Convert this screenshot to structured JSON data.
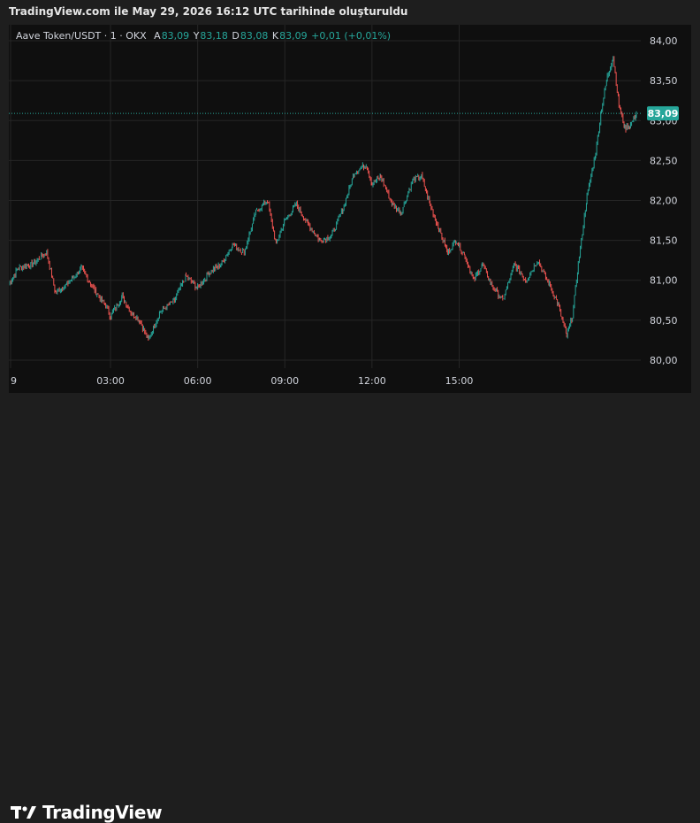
{
  "snapshot_title": "TradingView.com ile May 29, 2026 16:12 UTC tarihinde oluşturuldu",
  "legend": {
    "symbol": "Aave Token/USDT · 1 · OKX",
    "open_label": "A",
    "open": "83,09",
    "high_label": "Y",
    "high": "83,18",
    "low_label": "D",
    "low": "83,08",
    "close_label": "K",
    "close": "83,09",
    "change": "+0,01 (+0,01%)"
  },
  "price_tag": "83,09",
  "brand_name": "TradingView",
  "colors": {
    "up": "#26a69a",
    "down": "#ef5350",
    "panel_bg": "#0f0f0f",
    "page_bg": "#1e1e1e",
    "grid": "#262626"
  },
  "chart_data": {
    "type": "line",
    "title": "Aave Token/USDT · 1 · OKX",
    "xlabel": "",
    "ylabel": "",
    "x_ticks": [
      {
        "label": "9",
        "hours": -0.5
      },
      {
        "label": "03:00",
        "hours": 3
      },
      {
        "label": "06:00",
        "hours": 6
      },
      {
        "label": "09:00",
        "hours": 9
      },
      {
        "label": "12:00",
        "hours": 12
      },
      {
        "label": "15:00",
        "hours": 15
      }
    ],
    "y_ticks": [
      "80,00",
      "80,50",
      "81,00",
      "81,50",
      "82,00",
      "82,50",
      "83,00",
      "83,50",
      "84,00"
    ],
    "ylim": [
      79.9,
      84.2
    ],
    "xlim": [
      -0.5,
      16.8
    ],
    "grid": true,
    "last_price": 83.09,
    "series": [
      {
        "values": [
          [
            -0.5,
            80.95
          ],
          [
            -0.2,
            81.15
          ],
          [
            0.3,
            81.2
          ],
          [
            0.8,
            81.35
          ],
          [
            1.1,
            80.85
          ],
          [
            1.5,
            80.95
          ],
          [
            2.0,
            81.15
          ],
          [
            2.5,
            80.85
          ],
          [
            2.8,
            80.7
          ],
          [
            3.0,
            80.55
          ],
          [
            3.4,
            80.8
          ],
          [
            3.7,
            80.6
          ],
          [
            4.0,
            80.5
          ],
          [
            4.3,
            80.25
          ],
          [
            4.7,
            80.6
          ],
          [
            5.2,
            80.75
          ],
          [
            5.6,
            81.05
          ],
          [
            6.0,
            80.9
          ],
          [
            6.4,
            81.1
          ],
          [
            6.8,
            81.2
          ],
          [
            7.2,
            81.45
          ],
          [
            7.6,
            81.35
          ],
          [
            8.0,
            81.85
          ],
          [
            8.4,
            82.0
          ],
          [
            8.7,
            81.45
          ],
          [
            9.0,
            81.75
          ],
          [
            9.4,
            81.95
          ],
          [
            9.8,
            81.7
          ],
          [
            10.2,
            81.5
          ],
          [
            10.6,
            81.55
          ],
          [
            11.0,
            81.9
          ],
          [
            11.4,
            82.35
          ],
          [
            11.8,
            82.45
          ],
          [
            12.0,
            82.2
          ],
          [
            12.3,
            82.3
          ],
          [
            12.7,
            81.95
          ],
          [
            13.0,
            81.85
          ],
          [
            13.4,
            82.25
          ],
          [
            13.7,
            82.3
          ],
          [
            14.0,
            81.95
          ],
          [
            14.3,
            81.65
          ],
          [
            14.6,
            81.35
          ],
          [
            14.9,
            81.5
          ],
          [
            15.2,
            81.3
          ],
          [
            15.5,
            81.0
          ],
          [
            15.8,
            81.2
          ],
          [
            16.1,
            80.95
          ],
          [
            16.5,
            80.75
          ],
          [
            16.9,
            81.2
          ],
          [
            17.3,
            81.0
          ],
          [
            17.7,
            81.25
          ],
          [
            18.1,
            80.95
          ],
          [
            18.4,
            80.7
          ],
          [
            18.7,
            80.3
          ],
          [
            18.9,
            80.55
          ],
          [
            19.1,
            81.2
          ],
          [
            19.4,
            82.05
          ],
          [
            19.7,
            82.6
          ],
          [
            19.9,
            83.15
          ],
          [
            20.1,
            83.55
          ],
          [
            20.3,
            83.8
          ],
          [
            20.5,
            83.2
          ],
          [
            20.7,
            82.9
          ],
          [
            20.9,
            82.95
          ],
          [
            21.1,
            83.09
          ]
        ]
      }
    ]
  }
}
